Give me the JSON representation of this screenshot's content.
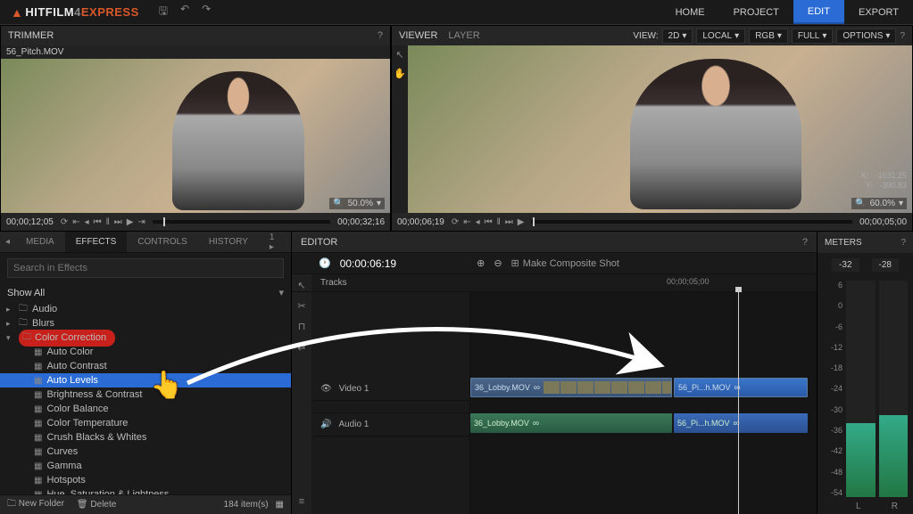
{
  "app": {
    "name_h": "HITFILM",
    "name_v": "4",
    "name_e": "EXPRESS"
  },
  "nav": {
    "home": "HOME",
    "project": "PROJECT",
    "edit": "EDIT",
    "export": "EXPORT"
  },
  "trimmer": {
    "title": "TRIMMER",
    "clip": "56_Pitch.MOV",
    "zoom": "50.0%",
    "tc_left": "00;00;12;05",
    "tc_right": "00;00;32;16"
  },
  "viewer": {
    "title": "VIEWER",
    "layer_tab": "LAYER",
    "view_label": "VIEW:",
    "view_mode": "2D",
    "local": "LOCAL",
    "rgb": "RGB",
    "full": "FULL",
    "options": "OPTIONS",
    "zoom": "60.0%",
    "tc": "00;00;06;19",
    "coord_x_label": "X:",
    "coord_x": "-1031.25",
    "coord_y_label": "Y:",
    "coord_y": "-390.83"
  },
  "effects_panel": {
    "tab_media": "MEDIA",
    "tab_effects": "EFFECTS",
    "tab_controls": "CONTROLS",
    "tab_history": "HISTORY",
    "tab_extra": "1 ▸",
    "search_placeholder": "Search in Effects",
    "filter": "Show All",
    "folders": {
      "audio": "Audio",
      "blurs": "Blurs",
      "color_correction": "Color Correction"
    },
    "cc_items": [
      "Auto Color",
      "Auto Contrast",
      "Auto Levels",
      "Brightness & Contrast",
      "Color Balance",
      "Color Temperature",
      "Crush Blacks & Whites",
      "Curves",
      "Gamma",
      "Hotspots",
      "Hue, Saturation & Lightness"
    ],
    "footer_new": "New Folder",
    "footer_delete": "Delete",
    "footer_count": "184 item(s)"
  },
  "editor": {
    "title": "EDITOR",
    "tc": "00:00:06:19",
    "composite": "Make Composite Shot",
    "tracks_label": "Tracks",
    "ruler_tick": "00;00;05;00",
    "video_track": "Video 1",
    "audio_track": "Audio 1",
    "clip1": "36_Lobby.MOV",
    "clip2": "56_Pi...h.MOV"
  },
  "meters": {
    "title": "METERS",
    "left_val": "-32",
    "right_val": "-28",
    "scale": [
      "6",
      "0",
      "-6",
      "-12",
      "-18",
      "-24",
      "-30",
      "-36",
      "-42",
      "-48",
      "-54"
    ],
    "l": "L",
    "r": "R"
  }
}
